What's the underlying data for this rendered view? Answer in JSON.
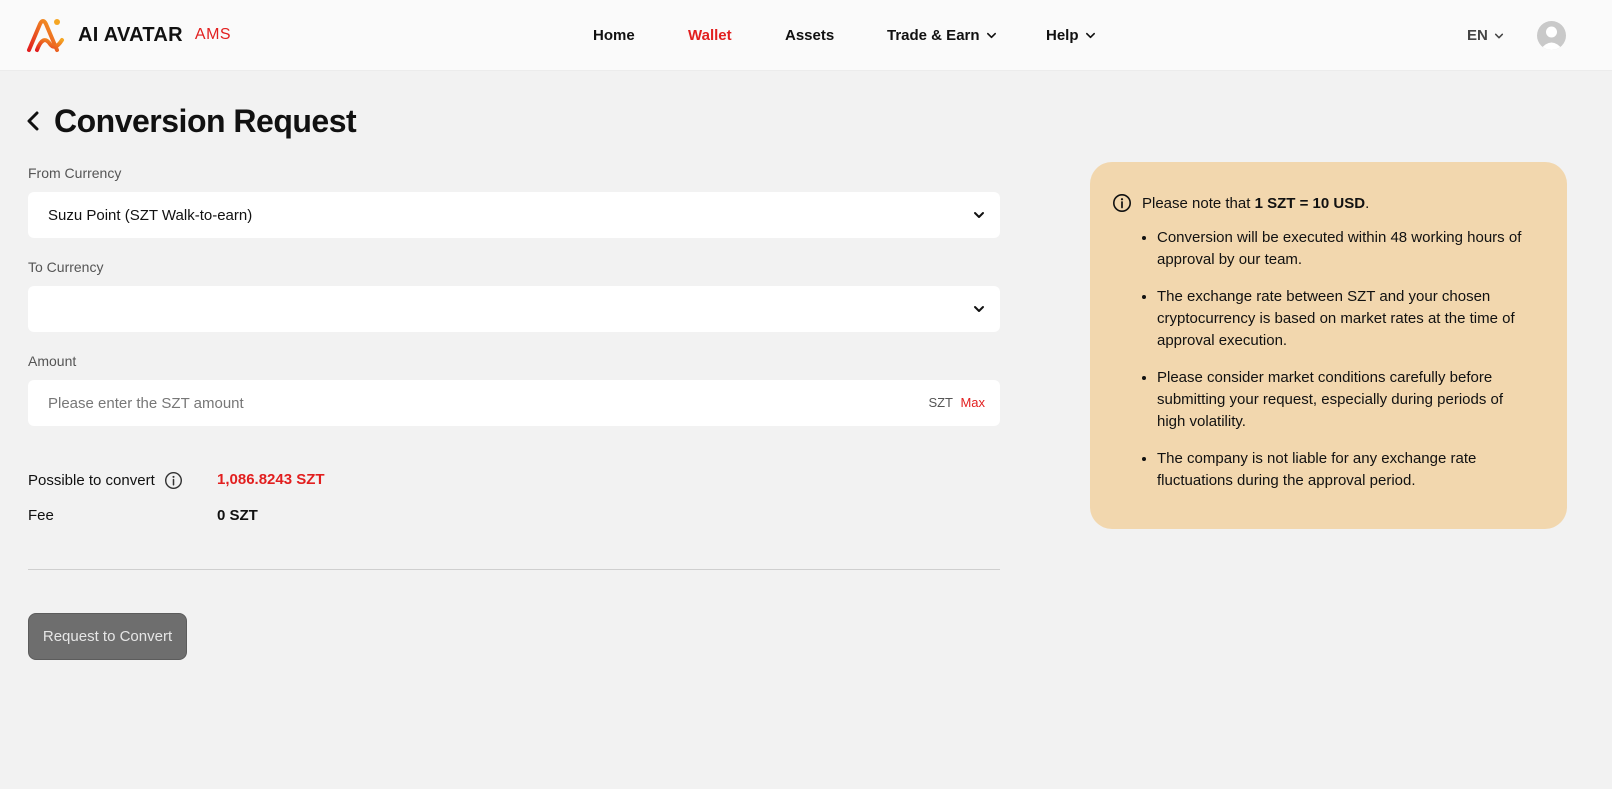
{
  "header": {
    "brand": "AI AVATAR",
    "brand_sub": "AMS",
    "nav": {
      "home": "Home",
      "wallet": "Wallet",
      "assets": "Assets",
      "trade": "Trade & Earn",
      "help": "Help"
    },
    "language": "EN"
  },
  "page": {
    "title": "Conversion Request"
  },
  "form": {
    "from_label": "From Currency",
    "from_value": "Suzu Point (SZT Walk-to-earn)",
    "to_label": "To Currency",
    "to_value": "",
    "amount_label": "Amount",
    "amount_placeholder": "Please enter the SZT amount",
    "amount_unit": "SZT",
    "max_label": "Max",
    "possible_label": "Possible to convert",
    "possible_value": "1,086.8243 SZT",
    "fee_label": "Fee",
    "fee_value": "0 SZT",
    "submit_label": "Request to Convert"
  },
  "notice": {
    "intro_prefix": "Please note that ",
    "intro_rate": "1 SZT = 10 USD",
    "intro_suffix": ".",
    "bullets": [
      "Conversion will be executed within 48 working hours of approval by our team.",
      "The exchange rate between SZT and your chosen cryptocurrency is based on market rates at the time of approval execution.",
      "Please consider market conditions carefully before submitting your request, especially during periods of high volatility.",
      "The company is not liable for any exchange rate fluctuations during the approval period."
    ]
  },
  "colors": {
    "accent": "#e21f1f",
    "notice_bg": "#f2d7ae",
    "page_bg": "#f2f2f2",
    "button_disabled": "#6e6e6e"
  }
}
